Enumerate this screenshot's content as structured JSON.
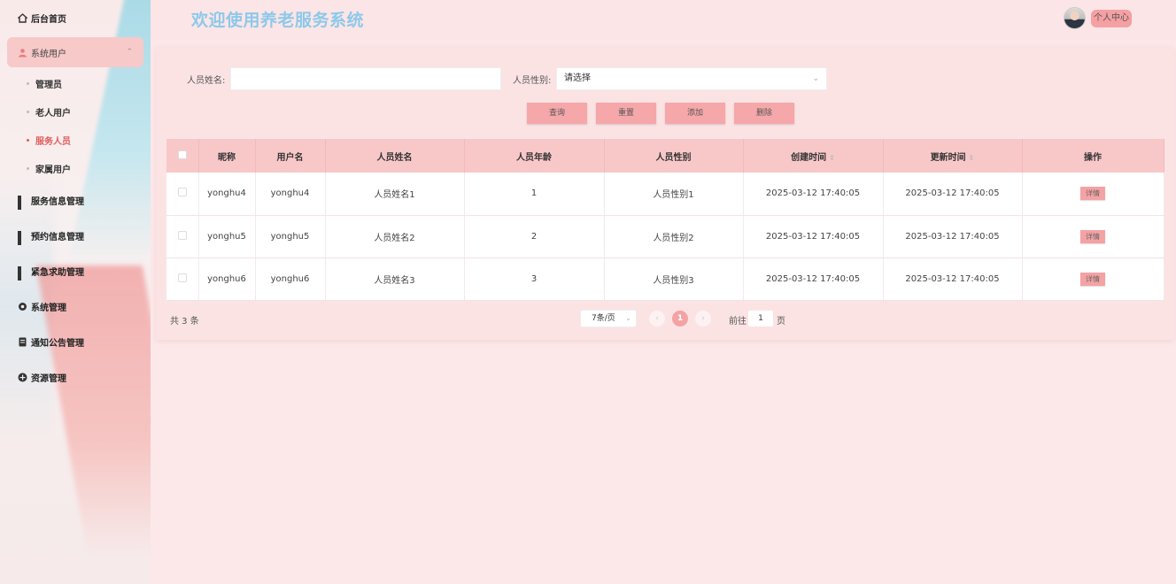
{
  "sidebar": {
    "items": [
      {
        "label": "后台首页",
        "icon": "home-icon"
      },
      {
        "label": "系统用户",
        "icon": "user-icon"
      },
      {
        "label": "服务信息管理",
        "icon": "grid-icon"
      },
      {
        "label": "预约信息管理",
        "icon": "grid-icon"
      },
      {
        "label": "紧急求助管理",
        "icon": "grid-icon"
      },
      {
        "label": "系统管理",
        "icon": "gear-icon"
      },
      {
        "label": "通知公告管理",
        "icon": "document-icon"
      },
      {
        "label": "资源管理",
        "icon": "plus-circle-icon"
      }
    ],
    "sub_items": [
      {
        "label": "管理员"
      },
      {
        "label": "老人用户"
      },
      {
        "label": "服务人员"
      },
      {
        "label": "家属用户"
      }
    ]
  },
  "header": {
    "title": "欢迎使用养老服务系统",
    "user_center": "个人中心"
  },
  "search": {
    "name_label": "人员姓名:",
    "name_value": "",
    "gender_label": "人员性别:",
    "gender_value": "请选择"
  },
  "buttons": {
    "query": "查询",
    "reset": "重置",
    "add": "添加",
    "delete": "删除"
  },
  "table": {
    "columns": [
      "昵称",
      "用户名",
      "人员姓名",
      "人员年龄",
      "人员性别",
      "创建时间",
      "更新时间",
      "操作"
    ],
    "rows": [
      {
        "nickname": "yonghu4",
        "username": "yonghu4",
        "name": "人员姓名1",
        "age": "1",
        "gender": "人员性别1",
        "created": "2025-03-12 17:40:05",
        "updated": "2025-03-12 17:40:05",
        "action": "详情"
      },
      {
        "nickname": "yonghu5",
        "username": "yonghu5",
        "name": "人员姓名2",
        "age": "2",
        "gender": "人员性别2",
        "created": "2025-03-12 17:40:05",
        "updated": "2025-03-12 17:40:05",
        "action": "详情"
      },
      {
        "nickname": "yonghu6",
        "username": "yonghu6",
        "name": "人员姓名3",
        "age": "3",
        "gender": "人员性别3",
        "created": "2025-03-12 17:40:05",
        "updated": "2025-03-12 17:40:05",
        "action": "详情"
      }
    ]
  },
  "pagination": {
    "total": "共 3 条",
    "page_size": "7条/页",
    "prev": "‹",
    "current_page": "1",
    "next": "›",
    "goto_label": "前往",
    "goto_value": "1",
    "page_suffix": "页"
  },
  "colors": {
    "accent": "#f4a3a5",
    "title": "#8cc9ea",
    "active_menu_text": "#e15d5d"
  }
}
